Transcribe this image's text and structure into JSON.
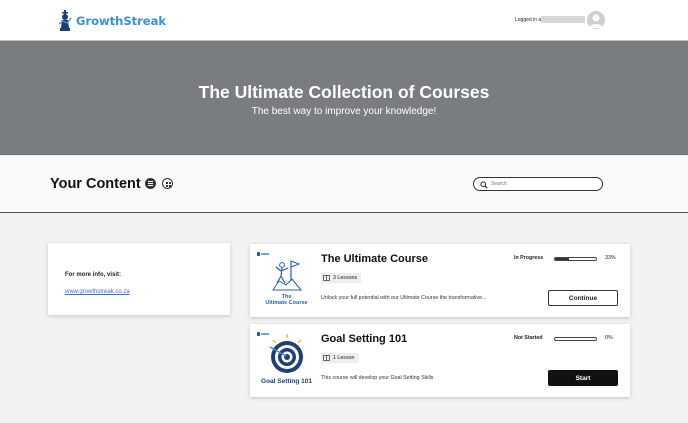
{
  "header": {
    "brand": "GrowthStreak",
    "logged_in_label": "Logged in as"
  },
  "hero": {
    "title": "The Ultimate Collection of Courses",
    "subtitle": "The best way to improve your knowledge!"
  },
  "content": {
    "title": "Your Content",
    "search_placeholder": "Search"
  },
  "info": {
    "label": "For more info, visit:",
    "link": "www.growthstreak.co.za"
  },
  "courses": [
    {
      "title": "The Ultimate Course",
      "lessons": "3 Lessons",
      "description": "Unlock your full potential with our Ultimate Course the transformative...",
      "status": "In Progress",
      "progress": 0.33,
      "percent": "33%",
      "button": "Continue",
      "thumb_caption_1": "The",
      "thumb_caption_2": "Ultimate Course"
    },
    {
      "title": "Goal Setting 101",
      "lessons": "1 Lesson",
      "description": "This course will develop your Goal Setting Skills",
      "status": "Not Started",
      "progress": 0,
      "percent": "0%",
      "button": "Start",
      "thumb_caption_1": "Goal Setting 101"
    }
  ],
  "colors": {
    "brand_blue": "#3d8fd6",
    "hero_bg": "#797d80",
    "link": "#3b6fd6"
  }
}
